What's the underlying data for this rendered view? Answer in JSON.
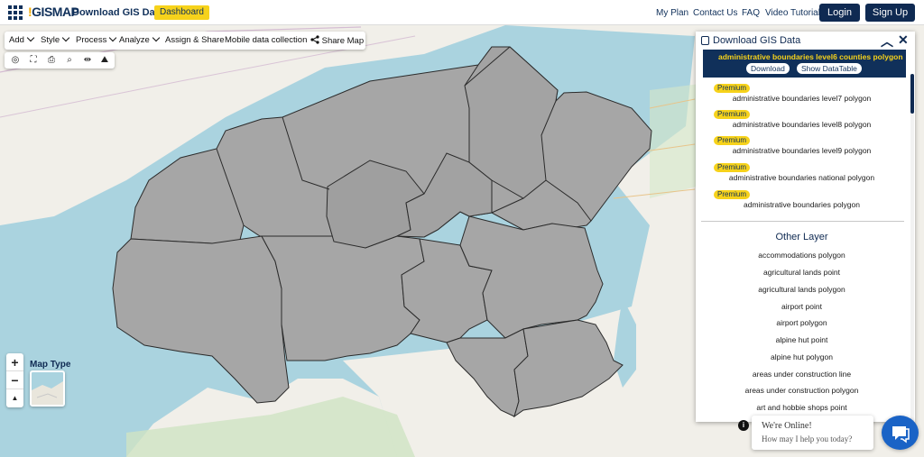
{
  "header": {
    "logo_text": "GISMAP",
    "app_title": "Download GIS Data",
    "dashboard_label": "Dashboard",
    "nav": [
      "My Plan",
      "Contact Us",
      "FAQ",
      "Video Tutorial"
    ],
    "login_label": "Login",
    "signup_label": "Sign Up"
  },
  "toolbar": {
    "add": "Add",
    "style": "Style",
    "process": "Process",
    "analyze": "Analyze",
    "assign_share": "Assign & Share",
    "mobile": "Mobile data collection",
    "share_map": "Share Map"
  },
  "map_controls": {
    "zoom_in": "+",
    "zoom_out": "−",
    "north": "▲",
    "map_type_label": "Map Type"
  },
  "panel": {
    "title": "Download GIS Data",
    "selected_layer": "administrative boundaries level6 counties polygon",
    "download_label": "Download",
    "show_table_label": "Show DataTable",
    "premium_badge": "Premium",
    "premium_layers": [
      "administrative boundaries level7 polygon",
      "administrative boundaries level8 polygon",
      "administrative boundaries level9 polygon",
      "administrative boundaries national polygon",
      "administrative boundaries polygon"
    ],
    "other_title": "Other Layer",
    "other_layers": [
      "accommodations polygon",
      "agricultural lands point",
      "agricultural lands polygon",
      "airport point",
      "airport polygon",
      "alpine hut point",
      "alpine hut polygon",
      "areas under construction line",
      "areas under construction polygon",
      "art and hobbie shops point"
    ]
  },
  "chat": {
    "online": "We're Online!",
    "help": "How may I help you today?"
  },
  "colors": {
    "navy": "#10305a",
    "accent_yellow": "#f6d21b",
    "county_fill": "#a6a6a6",
    "sea": "#aad3df",
    "land": "#f1efe9"
  }
}
